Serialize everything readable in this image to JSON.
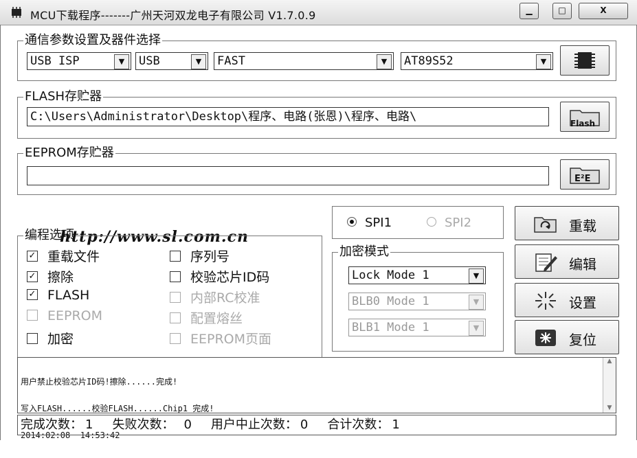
{
  "window": {
    "title": "MCU下载程序-------广州天河双龙电子有限公司 V1.7.0.9",
    "minimize_icon": "minimize-icon",
    "maximize_icon": "maximize-icon",
    "close_icon": "close-icon",
    "close_label": "X"
  },
  "comm": {
    "legend": "通信参数设置及器件选择",
    "protocol": "USB ISP",
    "port": "USB",
    "speed": "FAST",
    "device": "AT89S52",
    "chip_button_icon": "chip-icon"
  },
  "flash": {
    "legend": "FLASH存贮器",
    "path": "C:\\Users\\Administrator\\Desktop\\程序、电路(张恩)\\程序、电路\\",
    "button_label": "Flash"
  },
  "eeprom": {
    "legend": "EEPROM存贮器",
    "path": "",
    "button_label": "E²E"
  },
  "url": "http://www.sl.com.cn",
  "options": {
    "legend": "编程选项",
    "items": [
      {
        "label": "重载文件",
        "checked": true,
        "enabled": true
      },
      {
        "label": "擦除",
        "checked": true,
        "enabled": true
      },
      {
        "label": "FLASH",
        "checked": true,
        "enabled": true
      },
      {
        "label": "EEPROM",
        "checked": false,
        "enabled": false
      },
      {
        "label": "加密",
        "checked": false,
        "enabled": true
      },
      {
        "label": "序列号",
        "checked": false,
        "enabled": true
      },
      {
        "label": "校验芯片ID码",
        "checked": false,
        "enabled": true
      },
      {
        "label": "内部RC校准",
        "checked": false,
        "enabled": false
      },
      {
        "label": "配置熔丝",
        "checked": false,
        "enabled": false
      },
      {
        "label": "EEPROM页面",
        "checked": false,
        "enabled": false
      }
    ]
  },
  "spi": {
    "spi1": "SPI1",
    "spi2": "SPI2",
    "selected": "SPI1"
  },
  "encrypt": {
    "legend": "加密模式",
    "lock_mode": "Lock Mode 1",
    "blb0_mode": "BLB0 Mode 1",
    "blb1_mode": "BLB1 Mode 1"
  },
  "actions": {
    "reload": "重载",
    "edit": "编辑",
    "settings": "设置",
    "reset": "复位"
  },
  "log": {
    "lines": [
      "用户禁止校验芯片ID码!擦除......完成!",
      "写入FLASH......校验FLASH......Chip1 完成!",
      "2014:02:08  14:53:42"
    ]
  },
  "status": {
    "done_label": "完成次数：",
    "done_value": "1",
    "fail_label": "失败次数：",
    "fail_value": "0",
    "abort_label": "用户中止次数：",
    "abort_value": "0",
    "total_label": "合计次数：",
    "total_value": "1"
  }
}
